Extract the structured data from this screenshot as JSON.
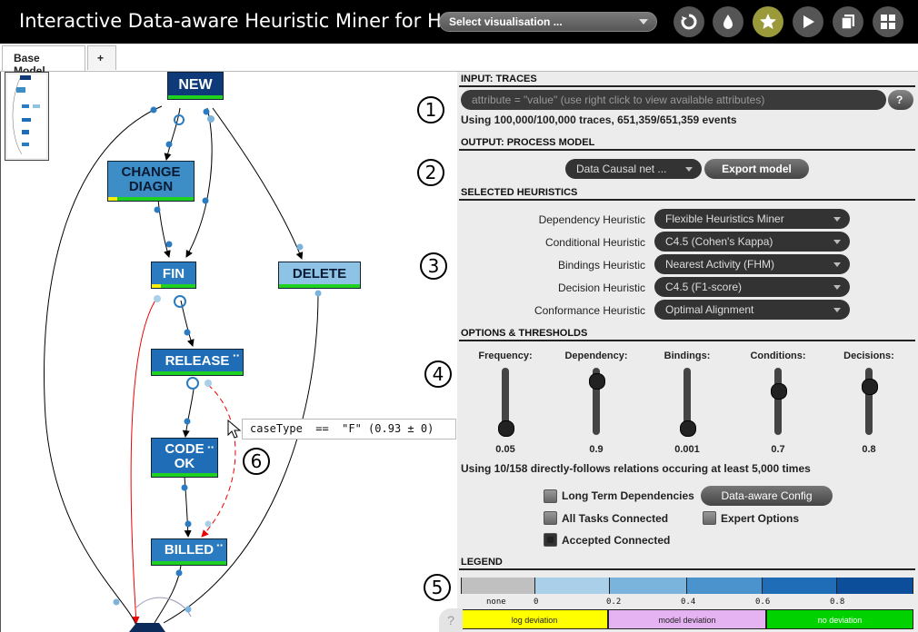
{
  "header": {
    "title": "Interactive Data-aware Heuristic Miner for Hospital B",
    "visualisation_select": "Select visualisation ...",
    "buttons": [
      {
        "icon": "refresh-icon"
      },
      {
        "icon": "drop-icon"
      },
      {
        "icon": "star-icon",
        "active": true
      },
      {
        "icon": "play-icon"
      },
      {
        "icon": "copy-icon"
      },
      {
        "icon": "grid-icon"
      }
    ],
    "colors": {
      "active_button": "#9b9a3a",
      "button": "#555555"
    }
  },
  "tabs": [
    {
      "label": "Base Model",
      "selected": true
    },
    {
      "label": "+"
    }
  ],
  "graph": {
    "nodes": [
      {
        "id": "new",
        "label": "NEW",
        "color": "#0e3a7a"
      },
      {
        "id": "change_diagn",
        "label": "CHANGE DIAGN",
        "label_lines": [
          "CHANGE",
          "DIAGN"
        ],
        "color": "#3d8dc6"
      },
      {
        "id": "fin",
        "label": "FIN",
        "color": "#2a7bc0"
      },
      {
        "id": "delete",
        "label": "DELETE",
        "color": "#8ec3e6"
      },
      {
        "id": "release",
        "label": "RELEASE",
        "color": "#1f6db6"
      },
      {
        "id": "code_ok",
        "label": "CODE OK",
        "label_lines": [
          "CODE",
          "OK"
        ],
        "color": "#1f6db6"
      },
      {
        "id": "billed",
        "label": "BILLED",
        "color": "#2a7bc0"
      }
    ],
    "tooltip": "caseType  ==  \"F\" (0.93 ± 0)"
  },
  "annotations": [
    "1",
    "2",
    "3",
    "4",
    "5",
    "6"
  ],
  "panel": {
    "input": {
      "title": "INPUT: TRACES",
      "filter_placeholder": "attribute = \"value\" (use right click to view available attributes)",
      "help_label": "?",
      "status": "Using 100,000/100,000 traces, 651,359/651,359 events"
    },
    "output": {
      "title": "OUTPUT: PROCESS MODEL",
      "model_type": "Data Causal net ...",
      "export_label": "Export model"
    },
    "heuristics": {
      "title": "SELECTED HEURISTICS",
      "rows": [
        {
          "label": "Dependency Heuristic",
          "value": "Flexible Heuristics Miner"
        },
        {
          "label": "Conditional Heuristic",
          "value": "C4.5 (Cohen's Kappa)"
        },
        {
          "label": "Bindings Heuristic",
          "value": "Nearest Activity (FHM)"
        },
        {
          "label": "Decision Heuristic",
          "value": "C4.5 (F1-score)"
        },
        {
          "label": "Conformance Heuristic",
          "value": "Optimal Alignment"
        }
      ]
    },
    "options": {
      "title": "OPTIONS & THRESHOLDS",
      "thresholds": [
        {
          "label": "Frequency:",
          "value": "0.05",
          "level": 0.0
        },
        {
          "label": "Dependency:",
          "value": "0.9",
          "level": 0.9
        },
        {
          "label": "Bindings:",
          "value": "0.001",
          "level": 0.0
        },
        {
          "label": "Conditions:",
          "value": "0.7",
          "level": 0.7
        },
        {
          "label": "Decisions:",
          "value": "0.8",
          "level": 0.8
        }
      ],
      "status": "Using 10/158 directly-follows relations occuring at least 5,000 times",
      "checkboxes": [
        {
          "label": "Long Term Dependencies",
          "checked": false
        },
        {
          "label": "All Tasks Connected",
          "checked": false
        },
        {
          "label": "Accepted Connected",
          "checked": true
        },
        {
          "label": "Expert Options",
          "checked": false
        }
      ],
      "data_aware_label": "Data-aware Config"
    },
    "legend": {
      "title": "LEGEND",
      "scale_colors": [
        "#c0c0c0",
        "#a9cfe9",
        "#7ab4dc",
        "#4a93cc",
        "#1f6db6",
        "#0c4e9a"
      ],
      "scale_ticks": [
        "none",
        "0",
        "0.2",
        "0.4",
        "0.6",
        "0.8"
      ],
      "deviations": [
        {
          "label": "log deviation",
          "color": "#ffff00"
        },
        {
          "label": "model deviation",
          "color": "#e6b3f2"
        },
        {
          "label": "no deviation",
          "color": "#00d200"
        }
      ]
    }
  }
}
